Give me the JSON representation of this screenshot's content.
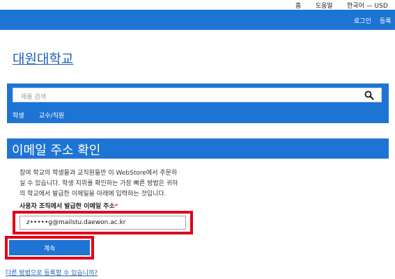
{
  "topbar": {
    "home": "홈",
    "help": "도움말",
    "language": "한국어 — USD"
  },
  "header": {
    "login": "로그인",
    "register": "등록"
  },
  "logo": "대원대학교",
  "search": {
    "placeholder": "제품 검색",
    "value": ""
  },
  "nav": {
    "student": "학생",
    "staff": "교수/직원"
  },
  "page": {
    "title": "이메일 주소 확인",
    "description_lines": [
      "참여 학교의 학생들과 교직원들만 이 WebStore에서 주문하",
      "실 수 있습니다. 학생 지위를 확인하는 가장 빠른 방법은 귀하",
      "의 학교에서 발급한 이메일을 아래에 입력하는 것입니다."
    ],
    "email_label": "사용자 조직에서 발급한 이메일 주소",
    "required_mark": "*",
    "email_value": "z•••••g@mailstu.daewon.ac.kr",
    "continue_button": "계속",
    "alt_link": "다른 방법으로 등록할 수 있습니까?"
  },
  "colors": {
    "brand_blue": "#1e74d4",
    "highlight_red": "#e0001b",
    "link_blue": "#1a5fb4"
  }
}
